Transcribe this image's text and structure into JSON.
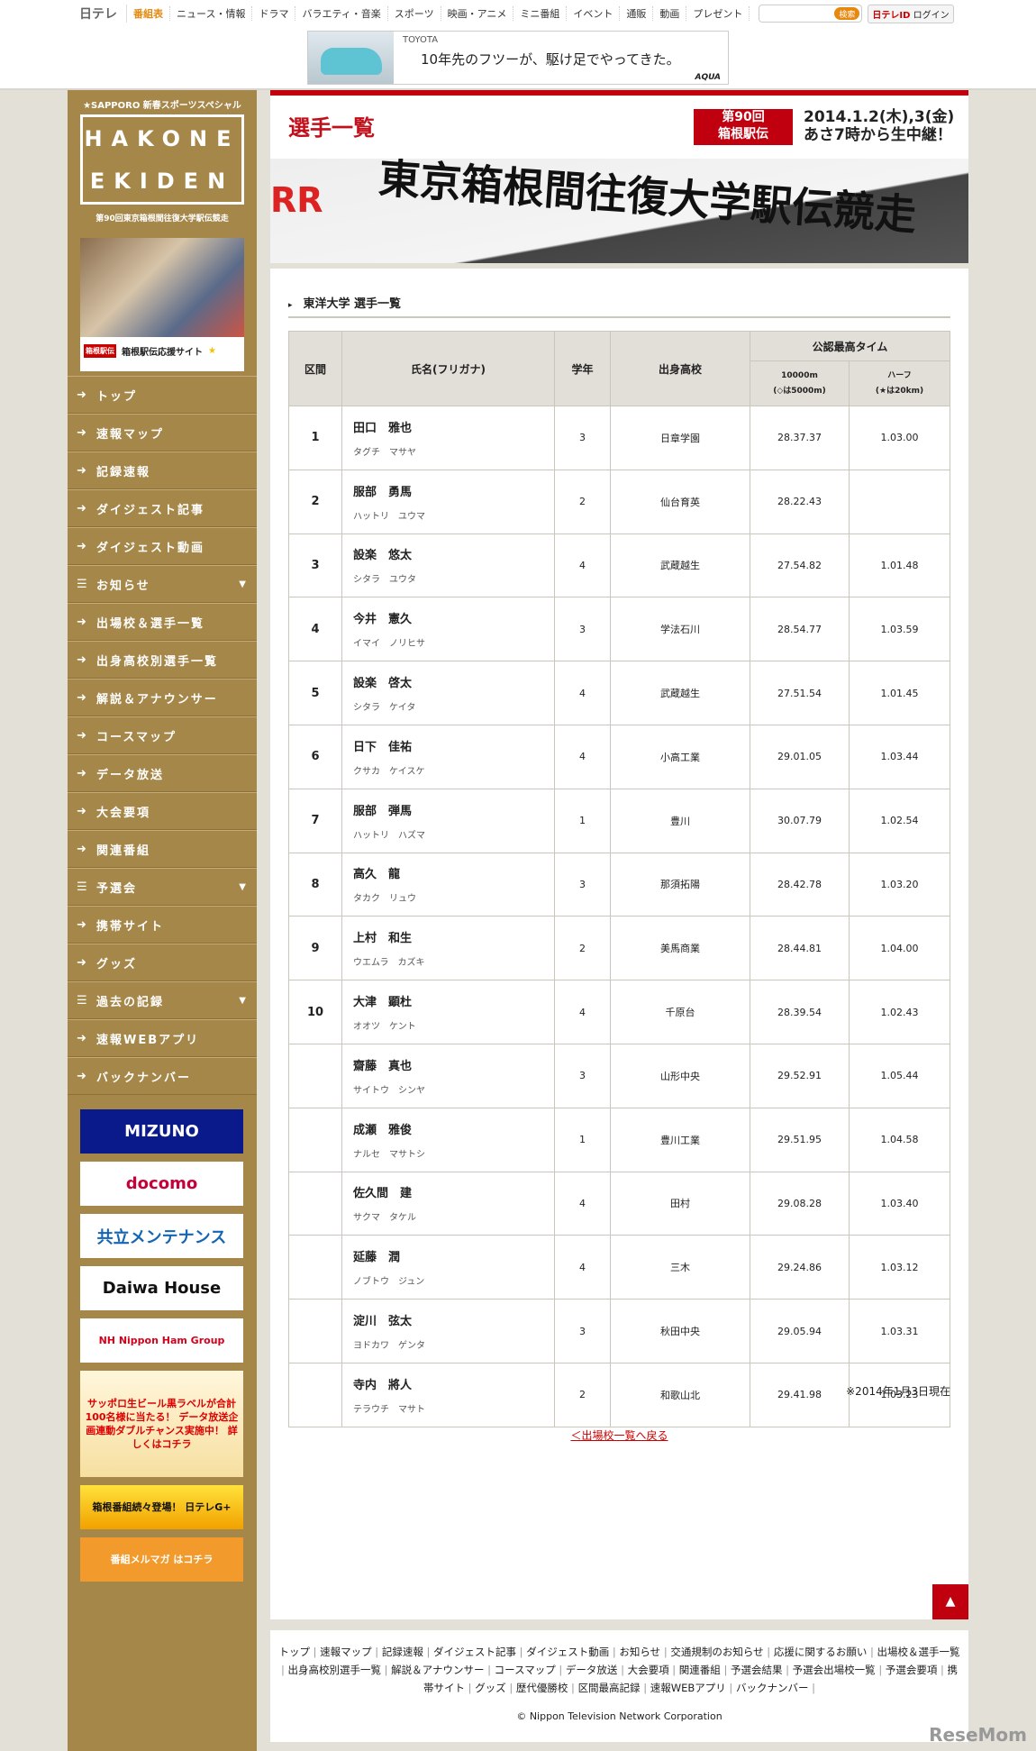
{
  "topnav": {
    "logo": "日テレ",
    "items": [
      "番組表",
      "ニュース・情報",
      "ドラマ",
      "バラエティ・音楽",
      "スポーツ",
      "映画・アニメ",
      "ミニ番組",
      "イベント",
      "通販",
      "動画",
      "プレゼント"
    ],
    "search_button": "検索",
    "login": "ログイン",
    "login_logo": "日テレID"
  },
  "ad": {
    "brand": "TOYOTA",
    "copy": "10年先のフツーが、駆け足でやってきた。",
    "model": "AQUA"
  },
  "sidebar": {
    "sponsor": "★SAPPORO 新春スポーツスペシャル",
    "logo_top": "HAKONE",
    "logo_bottom": "EKIDEN",
    "subtitle": "第90回東京箱根間往復大学駅伝競走",
    "photo_caption": "箱根駅伝応援サイト",
    "photo_badge": "箱根駅伝",
    "items": [
      {
        "label": "トップ",
        "icon": "arrow"
      },
      {
        "label": "速報マップ",
        "icon": "arrow"
      },
      {
        "label": "記録速報",
        "icon": "arrow"
      },
      {
        "label": "ダイジェスト記事",
        "icon": "arrow"
      },
      {
        "label": "ダイジェスト動画",
        "icon": "arrow"
      },
      {
        "label": "お知らせ",
        "icon": "list",
        "expand": true
      },
      {
        "label": "出場校＆選手一覧",
        "icon": "arrow"
      },
      {
        "label": "出身高校別選手一覧",
        "icon": "arrow"
      },
      {
        "label": "解説＆アナウンサー",
        "icon": "arrow"
      },
      {
        "label": "コースマップ",
        "icon": "arrow"
      },
      {
        "label": "データ放送",
        "icon": "arrow"
      },
      {
        "label": "大会要項",
        "icon": "arrow"
      },
      {
        "label": "関連番組",
        "icon": "arrow"
      },
      {
        "label": "予選会",
        "icon": "list",
        "expand": true
      },
      {
        "label": "携帯サイト",
        "icon": "arrow"
      },
      {
        "label": "グッズ",
        "icon": "arrow"
      },
      {
        "label": "過去の記録",
        "icon": "list",
        "expand": true
      },
      {
        "label": "速報WEBアプリ",
        "icon": "arrow"
      },
      {
        "label": "バックナンバー",
        "icon": "arrow"
      }
    ],
    "ads": [
      "MIZUNO",
      "docomo",
      "共立メンテナンス",
      "Daiwa House",
      "NH Nippon Ham Group",
      "サッポロ生ビール黒ラベルが合計100名様に当たる！ データ放送企画連動ダブルチャンス実施中！ 詳しくはコチラ",
      "箱根番組続々登場！ 日テレG+",
      "番組メルマガ はコチラ"
    ]
  },
  "header": {
    "title": "選手一覧",
    "badge_line1": "第90回",
    "badge_line2": "箱根駅伝",
    "date_line1": "2014.1.2(木),3(金)",
    "date_line2": "あさ7時から生中継！",
    "banner_text": "東京箱根間往復大学駅伝競走"
  },
  "section": {
    "title": "東洋大学 選手一覧"
  },
  "table": {
    "headers": {
      "section": "区間",
      "name": "氏名(フリガナ)",
      "grade": "学年",
      "school": "出身高校",
      "best": "公認最高タイム",
      "t10000": "10000m",
      "t10000_note": "(◇は5000m)",
      "half": "ハーフ",
      "half_note": "(★は20km)"
    },
    "rows": [
      {
        "sec": "1",
        "name": "田口　雅也",
        "kana": "タグチ　マサヤ",
        "grade": "3",
        "school": "日章学園",
        "t10000": "28.37.37",
        "half": "1.03.00"
      },
      {
        "sec": "2",
        "name": "服部　勇馬",
        "kana": "ハットリ　ユウマ",
        "grade": "2",
        "school": "仙台育英",
        "t10000": "28.22.43",
        "half": ""
      },
      {
        "sec": "3",
        "name": "設楽　悠太",
        "kana": "シタラ　ユウタ",
        "grade": "4",
        "school": "武蔵越生",
        "t10000": "27.54.82",
        "half": "1.01.48"
      },
      {
        "sec": "4",
        "name": "今井　憲久",
        "kana": "イマイ　ノリヒサ",
        "grade": "3",
        "school": "学法石川",
        "t10000": "28.54.77",
        "half": "1.03.59"
      },
      {
        "sec": "5",
        "name": "設楽　啓太",
        "kana": "シタラ　ケイタ",
        "grade": "4",
        "school": "武蔵越生",
        "t10000": "27.51.54",
        "half": "1.01.45"
      },
      {
        "sec": "6",
        "name": "日下　佳祐",
        "kana": "クサカ　ケイスケ",
        "grade": "4",
        "school": "小高工業",
        "t10000": "29.01.05",
        "half": "1.03.44"
      },
      {
        "sec": "7",
        "name": "服部　弾馬",
        "kana": "ハットリ　ハズマ",
        "grade": "1",
        "school": "豊川",
        "t10000": "30.07.79",
        "half": "1.02.54"
      },
      {
        "sec": "8",
        "name": "高久　龍",
        "kana": "タカク　リュウ",
        "grade": "3",
        "school": "那須拓陽",
        "t10000": "28.42.78",
        "half": "1.03.20"
      },
      {
        "sec": "9",
        "name": "上村　和生",
        "kana": "ウエムラ　カズキ",
        "grade": "2",
        "school": "美馬商業",
        "t10000": "28.44.81",
        "half": "1.04.00"
      },
      {
        "sec": "10",
        "name": "大津　顕杜",
        "kana": "オオツ　ケント",
        "grade": "4",
        "school": "千原台",
        "t10000": "28.39.54",
        "half": "1.02.43"
      },
      {
        "sec": "",
        "name": "齋藤　真也",
        "kana": "サイトウ　シンヤ",
        "grade": "3",
        "school": "山形中央",
        "t10000": "29.52.91",
        "half": "1.05.44"
      },
      {
        "sec": "",
        "name": "成瀬　雅俊",
        "kana": "ナルセ　マサトシ",
        "grade": "1",
        "school": "豊川工業",
        "t10000": "29.51.95",
        "half": "1.04.58"
      },
      {
        "sec": "",
        "name": "佐久間　建",
        "kana": "サクマ　タケル",
        "grade": "4",
        "school": "田村",
        "t10000": "29.08.28",
        "half": "1.03.40"
      },
      {
        "sec": "",
        "name": "延藤　潤",
        "kana": "ノブトウ　ジュン",
        "grade": "4",
        "school": "三木",
        "t10000": "29.24.86",
        "half": "1.03.12"
      },
      {
        "sec": "",
        "name": "淀川　弦太",
        "kana": "ヨドカワ　ゲンタ",
        "grade": "3",
        "school": "秋田中央",
        "t10000": "29.05.94",
        "half": "1.03.31"
      },
      {
        "sec": "",
        "name": "寺内　將人",
        "kana": "テラウチ　マサト",
        "grade": "2",
        "school": "和歌山北",
        "t10000": "29.41.98",
        "half": "1.03.23"
      }
    ]
  },
  "note": "※2014年1月3日現在",
  "back_link": "＜出場校一覧へ戻る",
  "footer": {
    "links": [
      "トップ",
      "速報マップ",
      "記録速報",
      "ダイジェスト記事",
      "ダイジェスト動画",
      "お知らせ",
      "交通規制のお知らせ",
      "応援に関するお願い",
      "出場校＆選手一覧",
      "出身高校別選手一覧",
      "解説＆アナウンサー",
      "コースマップ",
      "データ放送",
      "大会要項",
      "関連番組",
      "予選会結果",
      "予選会出場校一覧",
      "予選会要項",
      "携帯サイト",
      "グッズ",
      "歴代優勝校",
      "区間最高記録",
      "速報WEBアプリ",
      "バックナンバー"
    ],
    "copyright": "© Nippon Television Network Corporation"
  },
  "watermark": "ReseMom"
}
